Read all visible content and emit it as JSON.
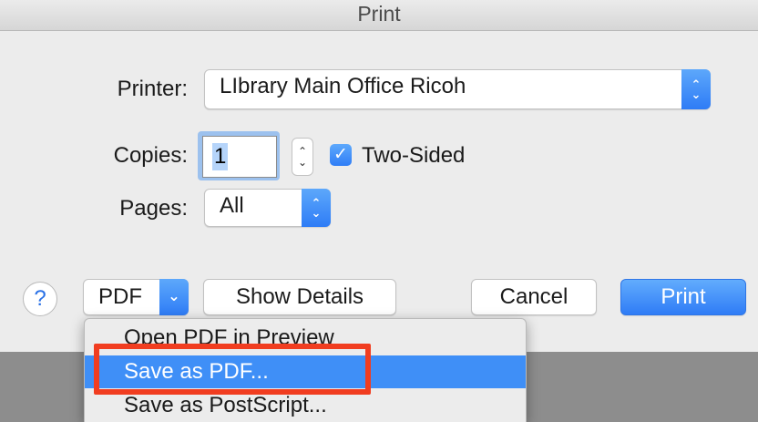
{
  "window": {
    "title": "Print"
  },
  "printer": {
    "label": "Printer:",
    "value": "LIbrary Main Office Ricoh"
  },
  "copies": {
    "label": "Copies:",
    "value": "1"
  },
  "two_sided": {
    "label": "Two-Sided",
    "checked": true
  },
  "pages": {
    "label": "Pages:",
    "value": "All"
  },
  "footer": {
    "help": "?",
    "pdf": "PDF",
    "show_details": "Show Details",
    "cancel": "Cancel",
    "print": "Print"
  },
  "pdf_menu": {
    "items": [
      {
        "label": "Open PDF in Preview"
      },
      {
        "label": "Save as PDF..."
      },
      {
        "label": "Save as PostScript..."
      }
    ],
    "selected_index": 1
  },
  "colors": {
    "accent": "#2f7cf6",
    "highlight_annotation": "#f13d20",
    "selection": "#3f8ff7"
  },
  "icons": {
    "stepper": "chevron-updown-icon",
    "dropdown": "chevron-down-icon",
    "check": "checkmark-icon"
  }
}
